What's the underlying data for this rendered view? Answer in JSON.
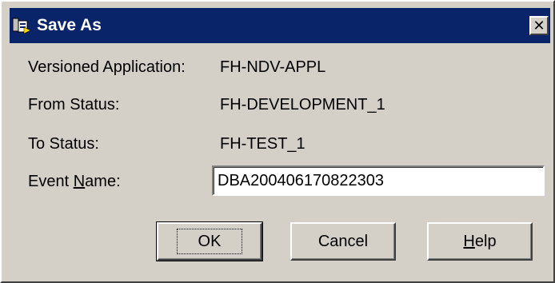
{
  "window": {
    "title": "Save As",
    "title_icon": "app-save-icon",
    "close_glyph": "✕"
  },
  "fields": {
    "versioned_application": {
      "label": "Versioned Application:",
      "value": "FH-NDV-APPL"
    },
    "from_status": {
      "label": "From Status:",
      "value": "FH-DEVELOPMENT_1"
    },
    "to_status": {
      "label": "To Status:",
      "value": "FH-TEST_1"
    },
    "event_name": {
      "label_before": "Event ",
      "label_mnemonic": "N",
      "label_after": "ame:",
      "value": "DBA200406170822303"
    }
  },
  "buttons": {
    "ok": {
      "label": "OK",
      "default": true
    },
    "cancel": {
      "label": "Cancel"
    },
    "help": {
      "label_mnemonic": "H",
      "label_after": "elp"
    }
  },
  "colors": {
    "face": "#d4d0c8",
    "titlebar": "#0a246a",
    "title_text": "#ffffff"
  }
}
